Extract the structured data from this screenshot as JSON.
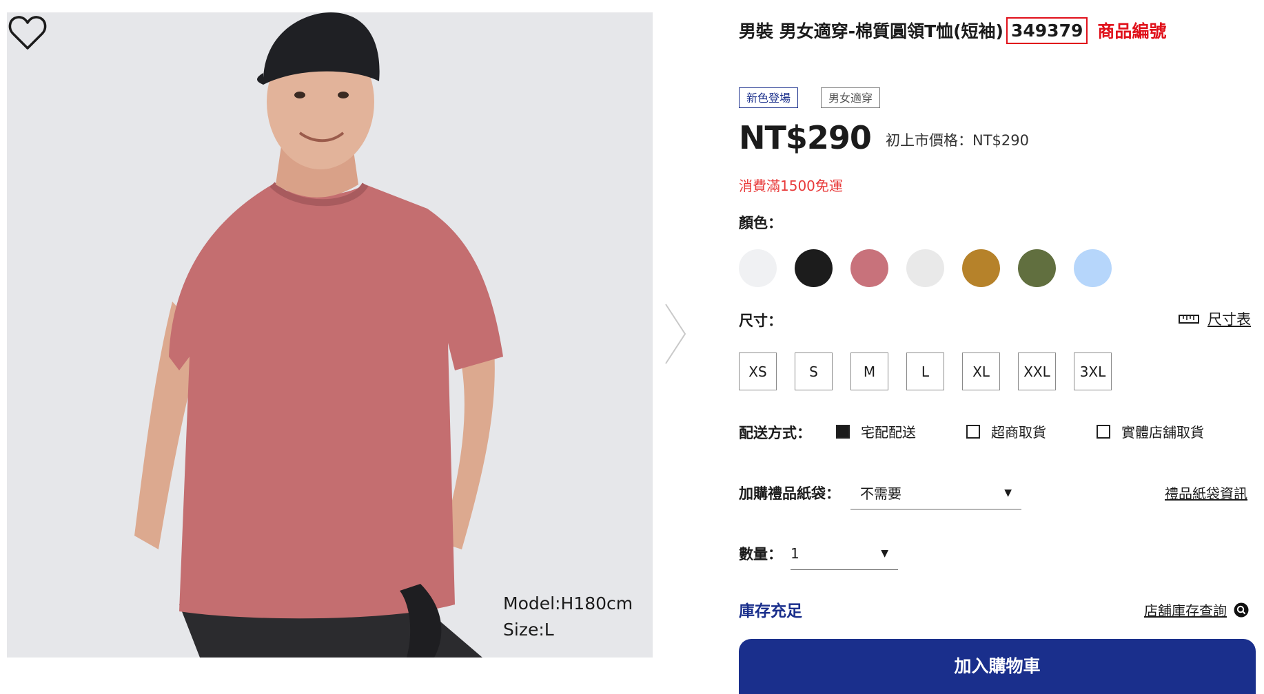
{
  "product": {
    "title": "男裝 男女適穿-棉質圓領T恤(短袖)",
    "sku": "349379",
    "sku_label": "商品編號",
    "tags": [
      "新色登場",
      "男女適穿"
    ],
    "price": "NT$290",
    "original_price": "初上市價格：NT$290",
    "shipping_note": "消費滿1500免運"
  },
  "image": {
    "model_height": "Model:H180cm",
    "model_size": "Size:L",
    "favorite_icon": "heart-outline-icon",
    "next_icon": "chevron-right-icon"
  },
  "color": {
    "label": "顏色：",
    "swatches": [
      "#f0f1f3",
      "#1c1c1c",
      "#c8727b",
      "#e9e9e9",
      "#b6822a",
      "#616f3f",
      "#b6d6fb"
    ]
  },
  "size": {
    "label": "尺寸：",
    "chart_link": "尺寸表",
    "chart_icon": "ruler-icon",
    "options": [
      "XS",
      "S",
      "M",
      "L",
      "XL",
      "XXL",
      "3XL"
    ]
  },
  "delivery": {
    "label": "配送方式：",
    "options": [
      {
        "label": "宅配配送",
        "checked": true
      },
      {
        "label": "超商取貨",
        "checked": false
      },
      {
        "label": "實體店舖取貨",
        "checked": false
      }
    ]
  },
  "gift_bag": {
    "label": "加購禮品紙袋：",
    "selected": "不需要",
    "info_link": "禮品紙袋資訊"
  },
  "quantity": {
    "label": "數量：",
    "selected": "1"
  },
  "stock": {
    "status": "庫存充足",
    "store_link": "店舖庫存查詢",
    "store_icon": "search-icon"
  },
  "cart": {
    "button_label": "加入購物車"
  },
  "colors": {
    "accent_blue": "#1a2f8c",
    "highlight_red": "#e0101a",
    "note_red": "#e83a3a"
  }
}
